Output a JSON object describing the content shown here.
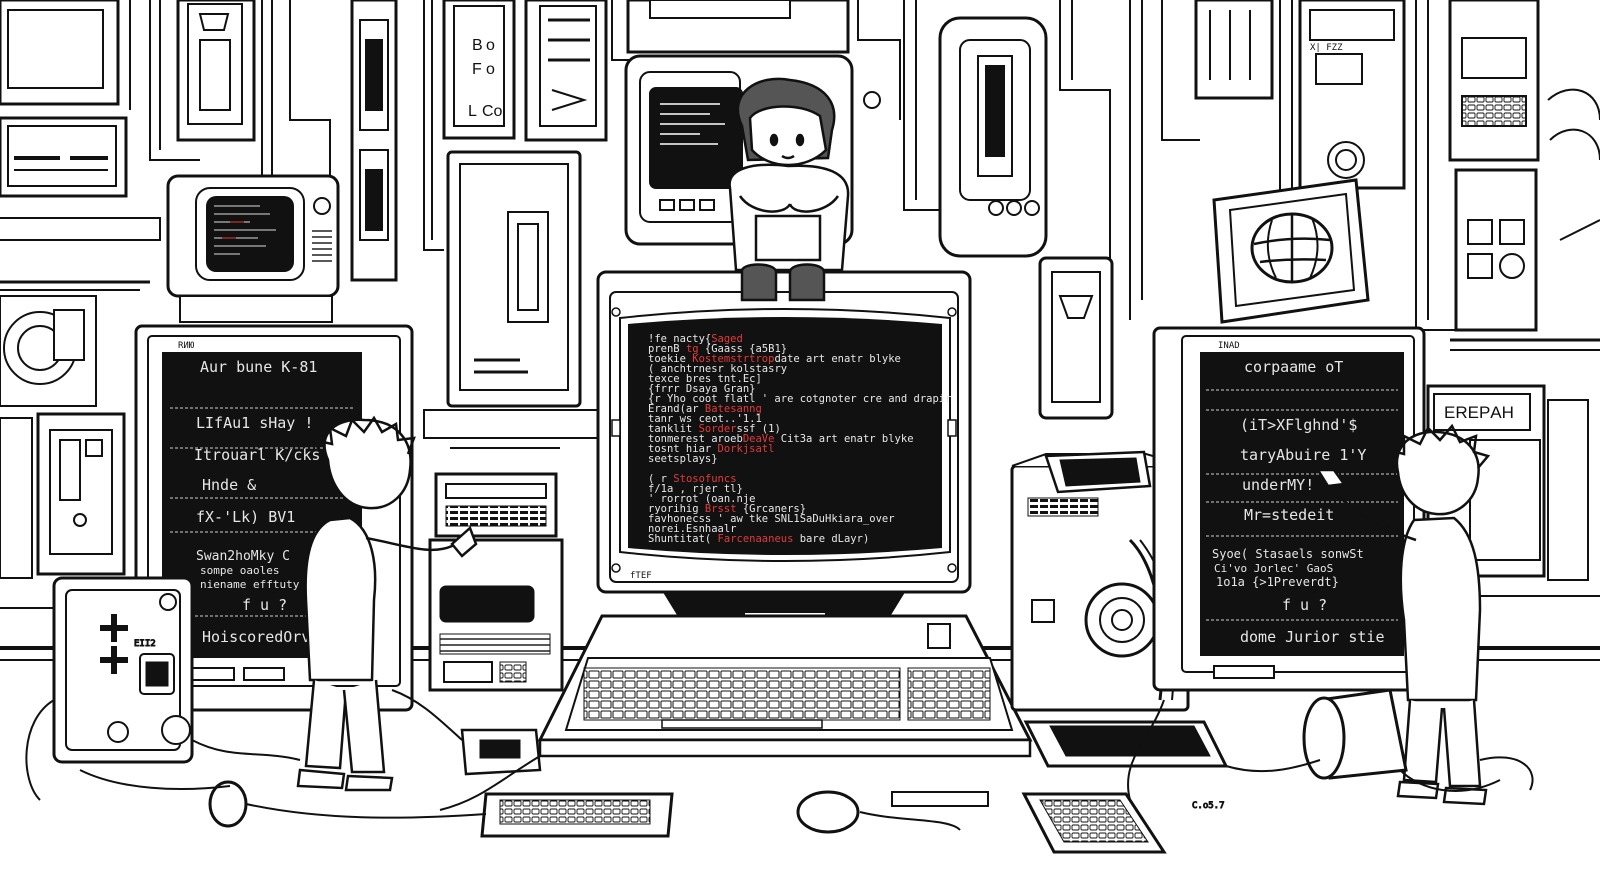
{
  "left_monitor": {
    "label": "RИЮ",
    "lines": [
      "Aur bune  K-81",
      "LIfAu1  sHay !",
      "Itrouarl K/cks",
      "Hnde  &",
      "fX-'Lk)  BV1",
      "Swan2hoMky  C",
      "sompe oaoles",
      "niename efftuty",
      "f u ?",
      "HoiscoredOrve"
    ]
  },
  "center_monitor": {
    "label": "fTEF",
    "lines": [
      {
        "t": "!fe  nacty{",
        "r": "Saged",
        "e": ""
      },
      {
        "t": "  prenB  ",
        "r": "tg",
        "e": " {Gaass {a5B1}"
      },
      {
        "t": "  toekie  ",
        "r": "Kostemstrtrop",
        "e": "date art enatr blyke"
      },
      {
        "t": "( anchtrnesr   ",
        "r": "",
        "e": "kolstasry"
      },
      {
        "t": "  texce bres  tnt.Ec]",
        "r": "",
        "e": ""
      },
      {
        "t": "  {frrr  Dsaya  Gran}",
        "r": "",
        "e": ""
      },
      {
        "t": "  {r  Yho coot  flatl ' are cotgnoter cre and drapir",
        "r": "",
        "e": ""
      },
      {
        "t": "  Erand(ar ",
        "r": "Batesanng",
        "e": ""
      },
      {
        "t": "    tanr  ws  ceot..'1.1",
        "r": "",
        "e": ""
      },
      {
        "t": "    tanklit  ",
        "r": "Sorder",
        "e": "ssf (1)"
      },
      {
        "t": "  tonmerest   aroeb",
        "r": "DeaVe",
        "e": " Cit3a art enatr blyke"
      },
      {
        "t": "  tosnt hiar ",
        "r": "Dorkjsatl",
        "e": ""
      },
      {
        "t": "  seetsplays}",
        "r": "",
        "e": ""
      },
      {
        "t": "",
        "r": "",
        "e": ""
      },
      {
        "t": "( r ",
        "r": "Stosofuncs",
        "e": ""
      },
      {
        "t": "    f/1a  , rjer  tl}",
        "r": "",
        "e": ""
      },
      {
        "t": "    '  rorrot  (oan.nje",
        "r": "",
        "e": ""
      },
      {
        "t": "    ryorihig ",
        "r": "Brsst",
        "e": " {Grcaners}"
      },
      {
        "t": "    favhonecss  ' aw  tke  SNL1SaDuHkiara_over",
        "r": "",
        "e": ""
      },
      {
        "t": "  norei.Esnhaalr",
        "r": "",
        "e": ""
      },
      {
        "t": "  Shuntitat(  ",
        "r": "Farcenaaneus",
        "e": "  bare dLayr)"
      }
    ]
  },
  "right_monitor": {
    "label": "INAD",
    "lines": [
      "corpaame  oT",
      "",
      "(iT>XFlghnd'$",
      "taryAbuire  1'Y",
      "underMY!",
      "Mr=stedeit",
      "Syoe(  Stasaels sonwSt",
      "Ci'vo Jorlec' GaoS",
      "1o1a  {>1Preverdt}",
      "f u ?",
      "dome  Jurior  stie"
    ]
  },
  "sign": {
    "text": "ERЕРAН"
  },
  "wall_labels": {
    "top_panel": [
      "B",
      "o",
      "F",
      "o",
      "L",
      "Co"
    ],
    "tag_right": "X| FZZ",
    "desk_tag": "C.o5.7",
    "left_device": "EII2"
  }
}
